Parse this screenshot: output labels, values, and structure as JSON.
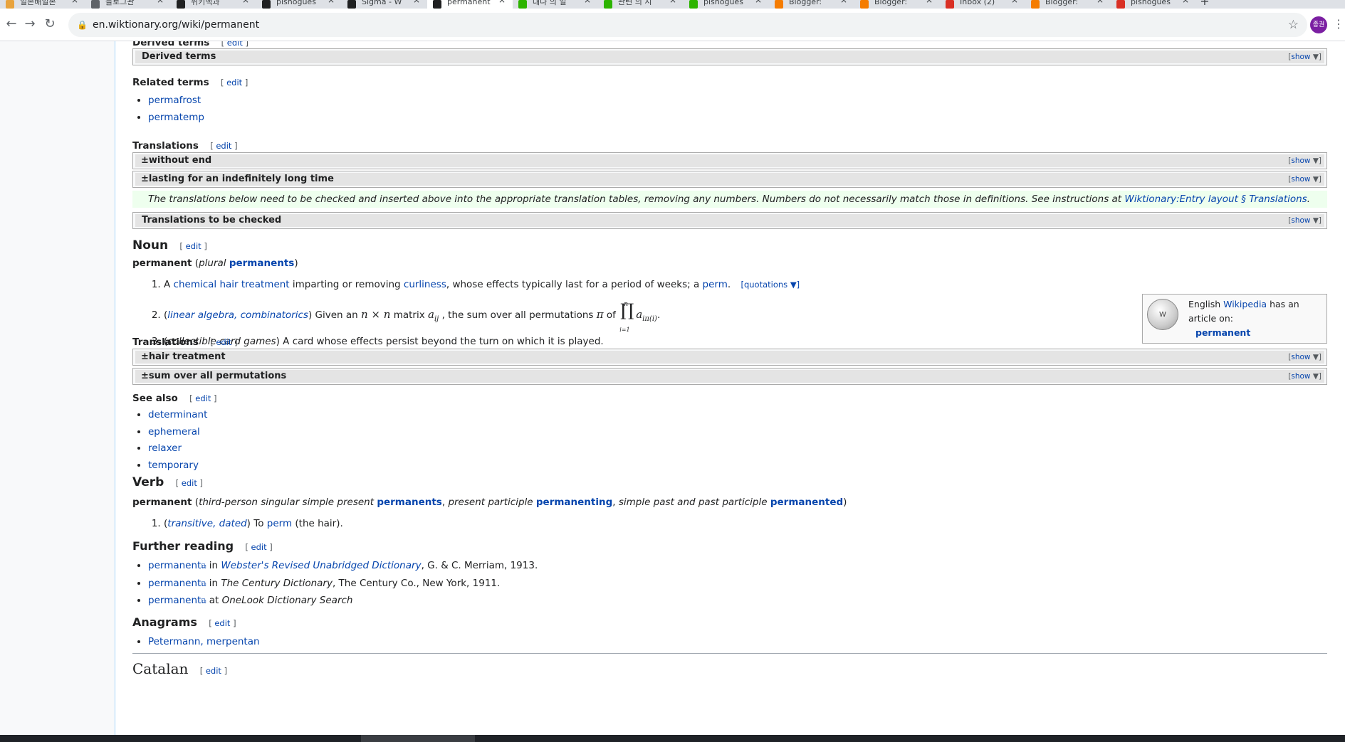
{
  "tabs": [
    {
      "title": "일본배일본",
      "color": "#e8a33d"
    },
    {
      "title": "블로그관",
      "color": "#5f6368"
    },
    {
      "title": "위키백과",
      "color": "#202122"
    },
    {
      "title": "pishogues",
      "color": "#202122"
    },
    {
      "title": "Sigma - W",
      "color": "#202122"
    },
    {
      "title": "permanent",
      "color": "#202122",
      "active": true
    },
    {
      "title": "대나 의 일",
      "color": "#2db400"
    },
    {
      "title": "관련 의 시",
      "color": "#2db400"
    },
    {
      "title": "pishogues",
      "color": "#2db400"
    },
    {
      "title": "Blogger: ",
      "color": "#f57c00"
    },
    {
      "title": "Blogger: ",
      "color": "#f57c00"
    },
    {
      "title": "Inbox (2)",
      "color": "#d93025"
    },
    {
      "title": "Blogger: ",
      "color": "#f57c00"
    },
    {
      "title": "pishogues",
      "color": "#d93025"
    }
  ],
  "toolbar": {
    "url": "en.wiktionary.org/wiki/permanent",
    "avatar": "종권"
  },
  "common": {
    "edit": "edit",
    "show": "show",
    "pm": "±"
  },
  "derived": {
    "heading": "Derived terms",
    "box": "Derived terms"
  },
  "related": {
    "heading": "Related terms",
    "items": [
      "permafrost",
      "permatemp"
    ]
  },
  "translations1": {
    "heading": "Translations",
    "boxes": [
      "without end",
      "lasting for an indefinitely long time"
    ],
    "notice_text": "The translations below need to be checked and inserted above into the appropriate translation tables, removing any numbers. Numbers do not necessarily match those in definitions. See instructions at ",
    "notice_link": "Wiktionary:Entry layout § Translations",
    "check_box": "Translations to be checked"
  },
  "noun": {
    "heading": "Noun",
    "headword": "permanent",
    "plural_label": "plural",
    "plural": "permanents",
    "def1": {
      "pre": "A ",
      "link1": "chemical hair treatment",
      "mid": " imparting or removing ",
      "link2": "curliness",
      "post": ", whose effects typically last for a period of weeks; a ",
      "link3": "perm",
      "end": ".",
      "quotations": "quotations ▼"
    },
    "def2": {
      "labels": "linear algebra, combinatorics",
      "pre": " Given an ",
      "n1": "n × n",
      "mid": " matrix ",
      "aij": "a",
      "aij_sub": "ij",
      "post": " , the sum over all permutations ",
      "pi": "π",
      "of": " of ",
      "prod_top": "n",
      "prod": "∏",
      "prod_bot": "i=1",
      "term": "a",
      "term_sub": "iπ(i)",
      "end": "."
    },
    "def3": {
      "labels": "collectible card games",
      "text": " A card whose effects persist beyond the turn on which it is played."
    },
    "wikipedia": {
      "pre": "English ",
      "link": "Wikipedia",
      "post": " has an article on:",
      "article": "permanent"
    }
  },
  "translations2": {
    "heading": "Translations",
    "boxes": [
      "hair treatment",
      "sum over all permutations"
    ]
  },
  "seealso": {
    "heading": "See also",
    "items": [
      "determinant",
      "ephemeral",
      "relaxer",
      "temporary"
    ]
  },
  "verb": {
    "heading": "Verb",
    "headword": "permanent",
    "f1_label": "third-person singular simple present",
    "f1": "permanents",
    "f2_label": "present participle",
    "f2": "permanenting",
    "f3_label": "simple past and past participle",
    "f3": "permanented",
    "def1": {
      "labels": "transitive, dated",
      "pre": " To ",
      "link": "perm",
      "post": " (the hair)."
    }
  },
  "further": {
    "heading": "Further reading",
    "items": [
      {
        "link": "permanent",
        "mid": " in ",
        "work": "Webster's Revised Unabridged Dictionary",
        "post": ", G. & C. Merriam, 1913.",
        "work_link": true
      },
      {
        "link": "permanent",
        "mid": " in ",
        "work": "The Century Dictionary",
        "post": ", The Century Co., New York, 1911.",
        "work_link": false
      },
      {
        "link": "permanent",
        "mid": " at ",
        "work": "OneLook Dictionary Search",
        "post": "",
        "work_link": false
      }
    ]
  },
  "anagrams": {
    "heading": "Anagrams",
    "items": "Petermann, merpentan"
  },
  "catalan": {
    "heading": "Catalan"
  }
}
